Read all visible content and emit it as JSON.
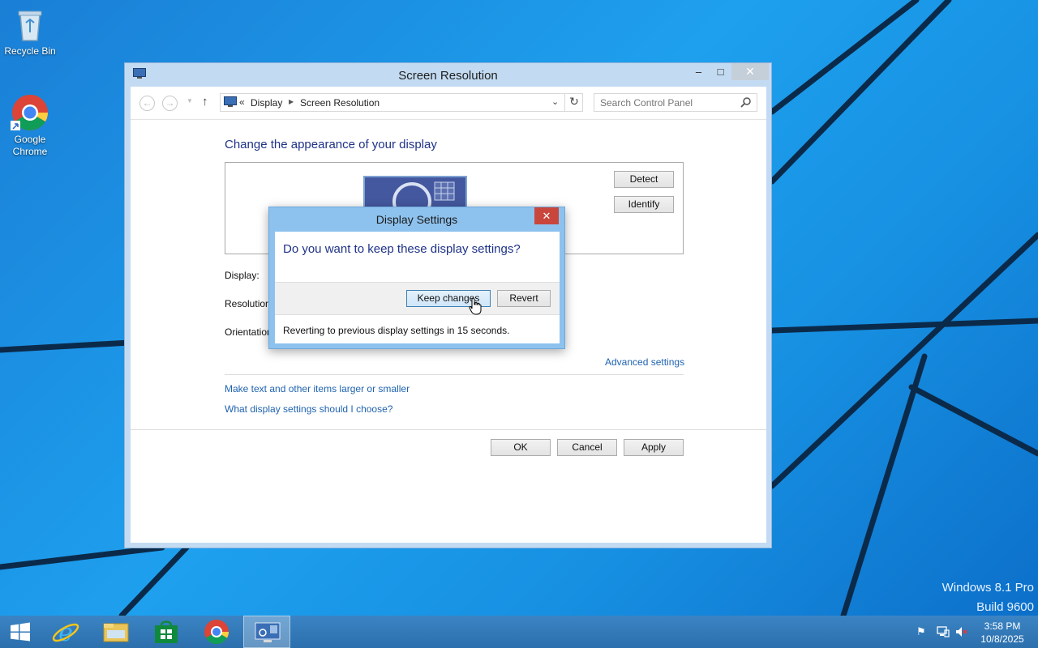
{
  "desktop": {
    "icons": [
      {
        "label": "Recycle Bin",
        "icon": "recycle-bin-icon"
      },
      {
        "label": "Google Chrome",
        "icon": "chrome-icon"
      }
    ],
    "watermark": {
      "line1": "Windows 8.1 Pro",
      "line2": "Build 9600"
    }
  },
  "window": {
    "title": "Screen Resolution",
    "controls": {
      "minimize": "–",
      "maximize": "□",
      "close": "✕"
    },
    "address": {
      "chevrons": "«",
      "crumbs": [
        "Display",
        "Screen Resolution"
      ]
    },
    "search": {
      "placeholder": "Search Control Panel"
    },
    "heading": "Change the appearance of your display",
    "detect_label": "Detect",
    "identify_label": "Identify",
    "fields": {
      "display": "Display:",
      "resolution": "Resolution:",
      "orientation": "Orientation:"
    },
    "advanced_link": "Advanced settings",
    "links": [
      "Make text and other items larger or smaller",
      "What display settings should I choose?"
    ],
    "buttons": {
      "ok": "OK",
      "cancel": "Cancel",
      "apply": "Apply"
    }
  },
  "dialog": {
    "title": "Display Settings",
    "close": "✕",
    "question": "Do you want to keep these display settings?",
    "keep_label": "Keep changes",
    "revert_label": "Revert",
    "countdown": "Reverting to previous display settings in 15 seconds."
  },
  "taskbar": {
    "time": "3:58 PM",
    "date": "10/8/2025",
    "pinned": [
      "start-icon",
      "internet-explorer-icon",
      "file-explorer-icon",
      "store-icon",
      "chrome-icon",
      "display-settings-icon"
    ],
    "tray": [
      "action-center-flag-icon",
      "network-icon",
      "volume-muted-icon"
    ]
  },
  "colors": {
    "wallpaper": "#1ea0ee",
    "taskbar": "#3178b8",
    "window_frame": "#c3dbf2",
    "dialog_frame": "#8ec2ee",
    "heading_text": "#1e3287",
    "link_text": "#1f63b0",
    "close_red": "#c9463d"
  }
}
